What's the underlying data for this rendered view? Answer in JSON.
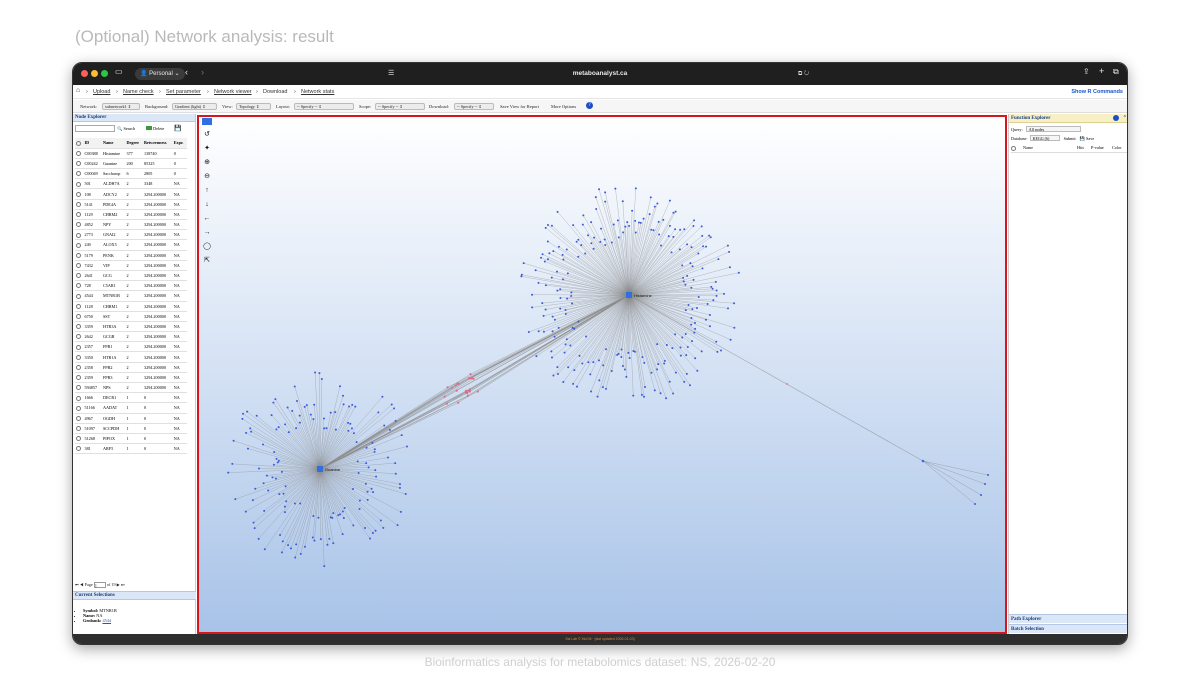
{
  "slide": {
    "title": "(Optional) Network analysis: result",
    "footer": "Bioinformatics analysis for metabolomics dataset: NS, 2026-02-20"
  },
  "browser": {
    "profile": "Personal",
    "url": "metaboanalyst.ca"
  },
  "breadcrumb": {
    "items": [
      "Upload",
      "Name check",
      "Set parameter",
      "Network viewer",
      "Download",
      "Network stats"
    ],
    "show_r": "Show R Commands"
  },
  "toolbar": {
    "network_label": "Network:",
    "network_value": "subnetwork1",
    "background_label": "Background:",
    "background_value": "Gradient (light)",
    "view_label": "View:",
    "view_value": "Topology",
    "layout_label": "Layout:",
    "layout_value": "-- Specify --",
    "scope_label": "Scope:",
    "scope_value": "-- Specify --",
    "download_label": "Download:",
    "download_value": "-- Specify --",
    "save_view": "Save View for Report",
    "more_options": "More Options"
  },
  "node_explorer": {
    "title": "Node Explorer",
    "search_label": "Search",
    "delete_label": "Delete",
    "columns": [
      "ID",
      "Name",
      "Degree",
      "Betweenness",
      "Expr."
    ],
    "rows": [
      [
        "C00388",
        "Histamine",
        "377",
        "138740",
        "0"
      ],
      [
        "C00242",
        "Guanine",
        "200",
        "85325",
        "0"
      ],
      [
        "C00049",
        "Saccharop",
        "6",
        "2805",
        "0"
      ],
      [
        "501",
        "ALDH7A",
        "2",
        "3348",
        "NA"
      ],
      [
        "108",
        "ADCY2",
        "2",
        "3294.200000",
        "NA"
      ],
      [
        "5141",
        "PDE4A",
        "2",
        "3294.200000",
        "NA"
      ],
      [
        "1129",
        "CHRM2",
        "2",
        "3294.200000",
        "NA"
      ],
      [
        "4852",
        "NPY",
        "2",
        "3294.200000",
        "NA"
      ],
      [
        "2773",
        "GNAI2",
        "2",
        "3294.200000",
        "NA"
      ],
      [
        "240",
        "ALOX5",
        "2",
        "3294.200000",
        "NA"
      ],
      [
        "5179",
        "PENK",
        "2",
        "3294.200000",
        "NA"
      ],
      [
        "7432",
        "VIP",
        "2",
        "3294.200000",
        "NA"
      ],
      [
        "2641",
        "GCG",
        "2",
        "3294.200000",
        "NA"
      ],
      [
        "728",
        "C5AR1",
        "2",
        "3294.200000",
        "NA"
      ],
      [
        "4544",
        "MTNR1B",
        "2",
        "3294.200000",
        "NA"
      ],
      [
        "1128",
        "CHRM1",
        "2",
        "3294.200000",
        "NA"
      ],
      [
        "6750",
        "SST",
        "2",
        "3294.200000",
        "NA"
      ],
      [
        "3359",
        "HTR3A",
        "2",
        "3294.200000",
        "NA"
      ],
      [
        "2642",
        "GCGR",
        "2",
        "3294.200000",
        "NA"
      ],
      [
        "2357",
        "FPR1",
        "2",
        "3294.200000",
        "NA"
      ],
      [
        "3350",
        "HTR1A",
        "2",
        "3294.200000",
        "NA"
      ],
      [
        "2358",
        "FPR2",
        "2",
        "3294.200000",
        "NA"
      ],
      [
        "2359",
        "FPR3",
        "2",
        "3294.200000",
        "NA"
      ],
      [
        "594857",
        "NPS",
        "2",
        "3294.200000",
        "NA"
      ],
      [
        "1666",
        "DECR1",
        "1",
        "0",
        "NA"
      ],
      [
        "51166",
        "AADAT",
        "1",
        "0",
        "NA"
      ],
      [
        "4967",
        "OGDH",
        "1",
        "0",
        "NA"
      ],
      [
        "51097",
        "SCCPDH",
        "1",
        "0",
        "NA"
      ],
      [
        "51268",
        "PIPOX",
        "1",
        "0",
        "NA"
      ],
      [
        "381",
        "ARF5",
        "1",
        "0",
        "NA"
      ]
    ],
    "pager_page_label": "Page",
    "pager_page": "1",
    "pager_of": "of 19"
  },
  "current_selection": {
    "title": "Current Selections",
    "symbol_label": "Symbol:",
    "symbol": "MTNR1B",
    "name_label": "Name:",
    "name": "NA",
    "genbank_label": "Genbank:",
    "genbank": "4544"
  },
  "network": {
    "hub1": "Histamine",
    "hub2": "Guanine",
    "edge_color": "#8a8a8a",
    "node_color": "#3b5bdb",
    "hub_color": "#2f6fe0",
    "shared_node_color": "#e36b8a"
  },
  "function_explorer": {
    "title": "Function Explorer",
    "query_label": "Query:",
    "query_value": "All nodes",
    "database_label": "Database:",
    "database_value": "KEGG (6)",
    "submit": "Submit",
    "save": "Save",
    "columns": [
      "Name",
      "Hits",
      "P-value",
      "Color"
    ]
  },
  "path_explorer": {
    "title": "Path Explorer"
  },
  "batch_selection": {
    "title": "Batch Selection"
  },
  "status_bar": {
    "text": "Xia Lab © McGill · (last updated 2026-01-03)"
  }
}
